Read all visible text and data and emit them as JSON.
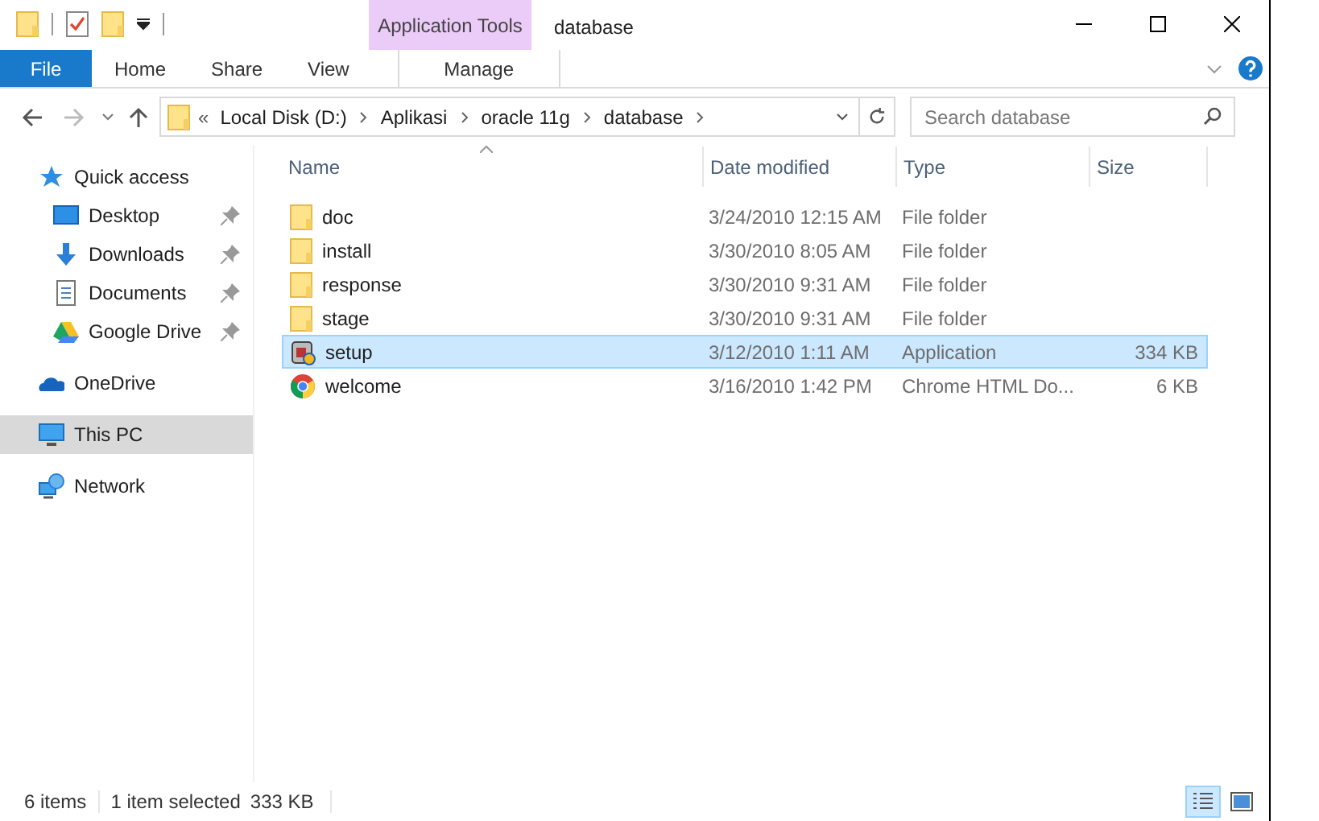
{
  "window": {
    "title": "database"
  },
  "context_tab": {
    "group": "Application Tools",
    "label": "Manage"
  },
  "ribbon_tabs": [
    {
      "label": "File",
      "kind": "file"
    },
    {
      "label": "Home",
      "kind": "tab"
    },
    {
      "label": "Share",
      "kind": "tab"
    },
    {
      "label": "View",
      "kind": "tab"
    }
  ],
  "address": {
    "overflow": "«",
    "path": [
      "Local Disk (D:)",
      "Aplikasi",
      "oracle 11g",
      "database"
    ]
  },
  "search": {
    "placeholder": "Search database"
  },
  "sidebar": {
    "items": [
      {
        "label": "Quick access",
        "kind": "star",
        "selected": false,
        "children": [
          {
            "label": "Desktop",
            "kind": "desktop",
            "pinned": true,
            "selected": false
          },
          {
            "label": "Downloads",
            "kind": "downloads",
            "pinned": true,
            "selected": false
          },
          {
            "label": "Documents",
            "kind": "documents",
            "pinned": true,
            "selected": false
          },
          {
            "label": "Google Drive",
            "kind": "drive",
            "pinned": true,
            "selected": false
          }
        ]
      },
      {
        "label": "OneDrive",
        "kind": "cloud",
        "selected": false
      },
      {
        "label": "This PC",
        "kind": "pc",
        "selected": true
      },
      {
        "label": "Network",
        "kind": "network",
        "selected": false
      }
    ]
  },
  "table": {
    "columns": [
      "Name",
      "Date modified",
      "Type",
      "Size"
    ],
    "rows": [
      {
        "kind": "folder",
        "name": "doc",
        "date": "3/24/2010 12:15 AM",
        "type": "File folder",
        "selected": false
      },
      {
        "kind": "folder",
        "name": "install",
        "date": "3/30/2010 8:05 AM",
        "type": "File folder",
        "selected": false
      },
      {
        "kind": "folder",
        "name": "response",
        "date": "3/30/2010 9:31 AM",
        "type": "File folder",
        "selected": false
      },
      {
        "kind": "folder",
        "name": "stage",
        "date": "3/30/2010 9:31 AM",
        "type": "File folder",
        "selected": false
      },
      {
        "kind": "app",
        "name": "setup",
        "date": "3/12/2010 1:11 AM",
        "type": "Application",
        "size": "334 KB",
        "selected": true
      },
      {
        "kind": "chrome",
        "name": "welcome",
        "date": "3/16/2010 1:42 PM",
        "type": "Chrome HTML Do...",
        "size": "6 KB",
        "selected": false
      }
    ]
  },
  "status_bar": {
    "count": "6 items",
    "selection": "1 item selected",
    "size": "333 KB",
    "views": [
      {
        "kind": "details",
        "selected": true
      },
      {
        "kind": "thumbnails",
        "selected": false
      }
    ]
  }
}
